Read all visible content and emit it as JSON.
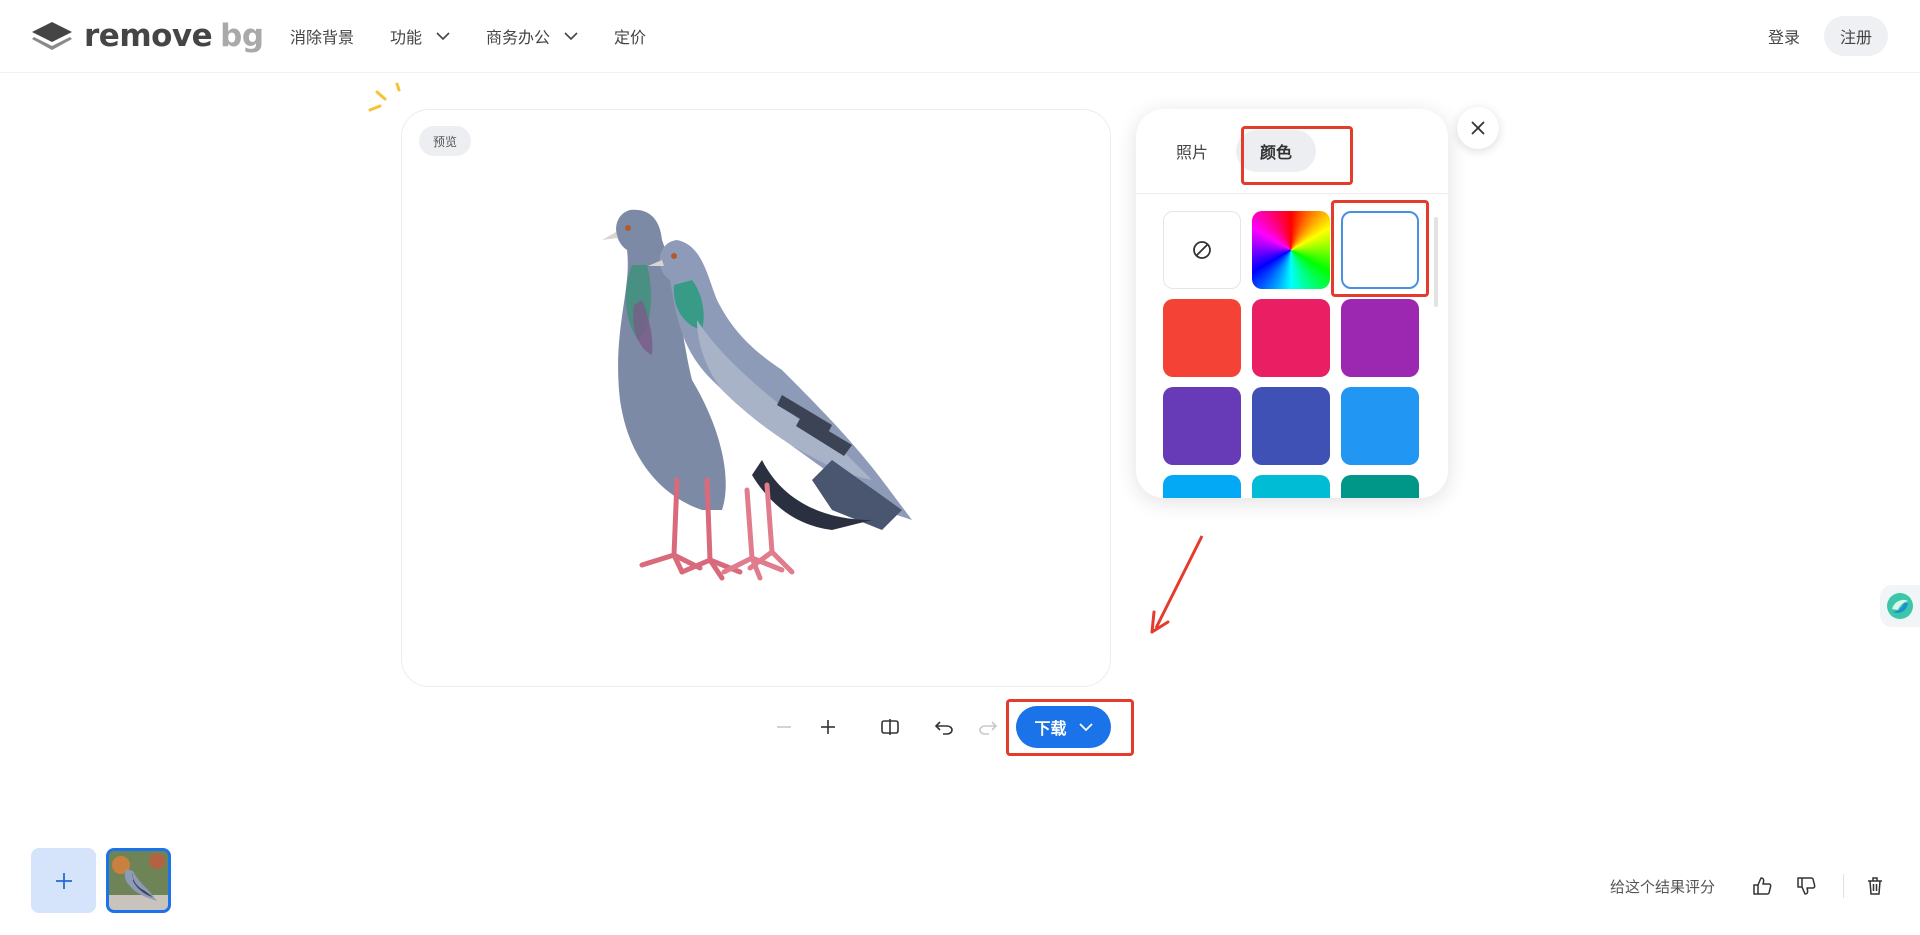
{
  "header": {
    "logo": {
      "text_main": "remove",
      "text_bg": "bg",
      "icon": "layers-logo-icon"
    },
    "nav": [
      {
        "label": "消除背景",
        "has_dropdown": false
      },
      {
        "label": "功能",
        "has_dropdown": true
      },
      {
        "label": "商务办公",
        "has_dropdown": true
      },
      {
        "label": "定价",
        "has_dropdown": false
      }
    ],
    "login_label": "登录",
    "signup_label": "注册"
  },
  "preview": {
    "badge": "预览"
  },
  "toolbar": {
    "icons": [
      "zoom-out-icon",
      "zoom-in-icon",
      "compare-icon",
      "undo-icon",
      "redo-icon"
    ],
    "download_label": "下载"
  },
  "panel": {
    "tabs": [
      {
        "label": "照片",
        "active": false
      },
      {
        "label": "颜色",
        "active": true
      }
    ],
    "swatches": [
      {
        "type": "none",
        "icon": "no-background-icon"
      },
      {
        "type": "rainbow",
        "color": "#ff0000"
      },
      {
        "type": "selected",
        "color": "#ffffff"
      },
      {
        "type": "color",
        "color": "#f44336"
      },
      {
        "type": "color",
        "color": "#e91e63"
      },
      {
        "type": "color",
        "color": "#9c27b0"
      },
      {
        "type": "color",
        "color": "#673ab7"
      },
      {
        "type": "color",
        "color": "#3f51b5"
      },
      {
        "type": "color",
        "color": "#2196f3"
      },
      {
        "type": "color",
        "color": "#03a9f4"
      },
      {
        "type": "color",
        "color": "#00bcd4"
      },
      {
        "type": "color",
        "color": "#009688"
      }
    ]
  },
  "bottom": {
    "rate_label": "给这个结果评分",
    "icons": [
      "thumbs-up-icon",
      "thumbs-down-icon",
      "trash-icon"
    ]
  },
  "colors": {
    "accent": "#1a73e8",
    "annotation": "#e53b2c"
  }
}
